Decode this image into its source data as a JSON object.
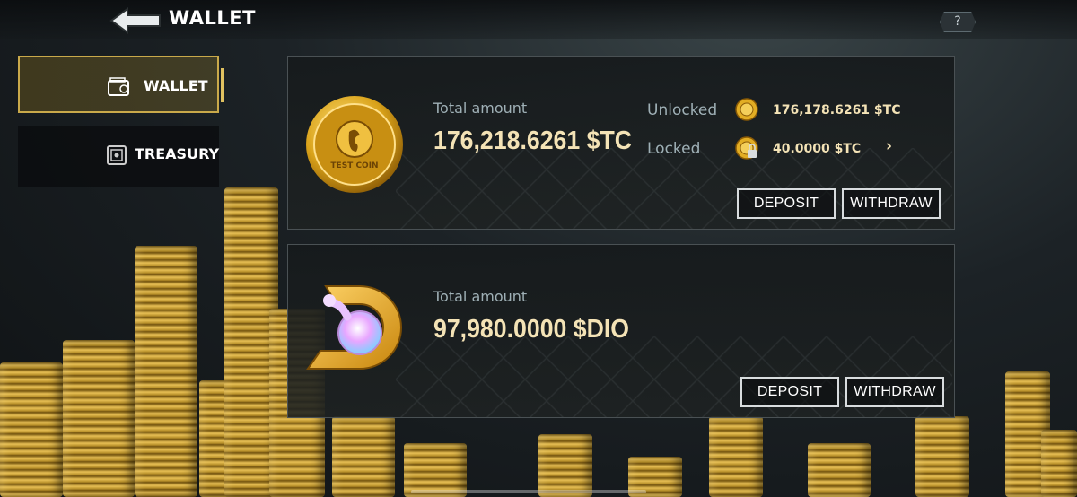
{
  "topbar": {
    "title": "WALLET",
    "help_label": "?"
  },
  "sidebar": {
    "items": [
      {
        "label": "WALLET",
        "icon": "wallet-icon",
        "active": true
      },
      {
        "label": "TREASURY",
        "icon": "safe-icon",
        "active": false
      }
    ]
  },
  "tc_card": {
    "total_label": "Total amount",
    "total_value": "176,218.6261 $TC",
    "unlocked_label": "Unlocked",
    "unlocked_value": "176,178.6261 $TC",
    "locked_label": "Locked",
    "locked_value": "40.0000 $TC",
    "chevron": "›",
    "deposit_label": "DEPOSIT",
    "withdraw_label": "WITHDRAW",
    "coin_text": "TEST COIN"
  },
  "dio_card": {
    "total_label": "Total amount",
    "total_value": "97,980.0000 $DIO",
    "deposit_label": "DEPOSIT",
    "withdraw_label": "WITHDRAW"
  },
  "colors": {
    "gold": "#c9a94a",
    "amount": "#f4e3b6",
    "muted": "#9fb0b6"
  }
}
